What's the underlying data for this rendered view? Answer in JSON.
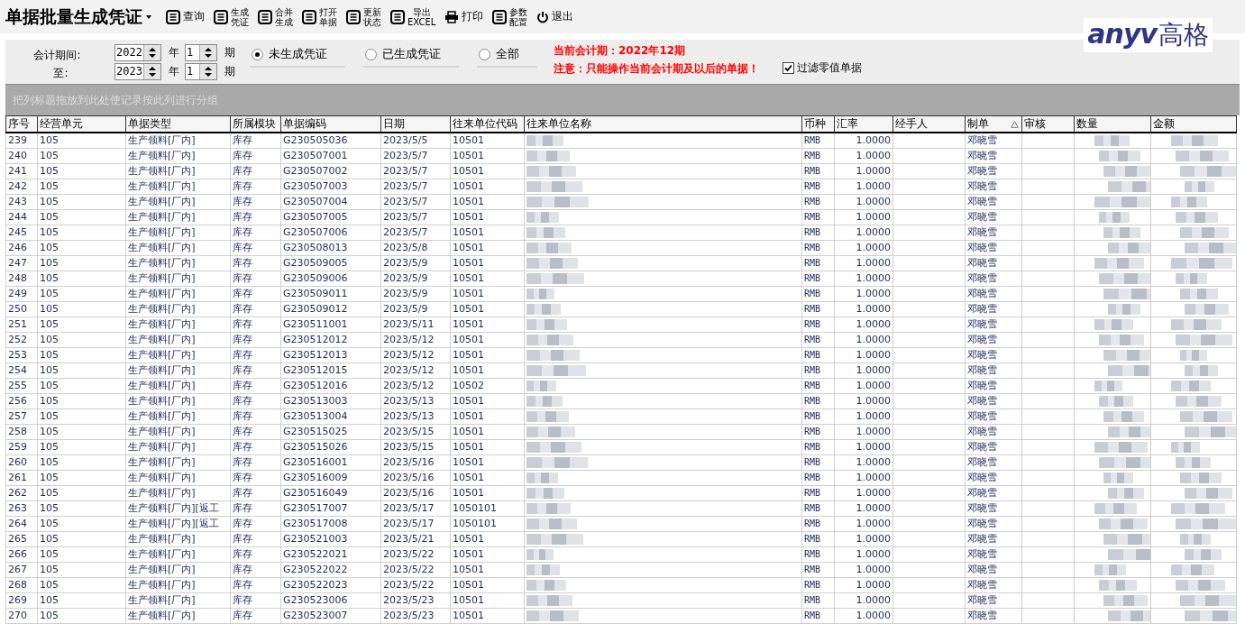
{
  "title": "单据批量生成凭证",
  "toolbar": [
    {
      "kind": "list",
      "lines": [
        "查询"
      ]
    },
    {
      "kind": "list",
      "lines": [
        "生成",
        "凭证"
      ]
    },
    {
      "kind": "list",
      "lines": [
        "合并",
        "生成"
      ]
    },
    {
      "kind": "list",
      "lines": [
        "打开",
        "单据"
      ]
    },
    {
      "kind": "list",
      "lines": [
        "更新",
        "状态"
      ]
    },
    {
      "kind": "list",
      "lines": [
        "导出",
        "EXCEL"
      ]
    },
    {
      "kind": "print",
      "lines": [
        "打印"
      ]
    },
    {
      "kind": "list",
      "lines": [
        "参数",
        "配置"
      ]
    },
    {
      "kind": "power",
      "lines": [
        "退出"
      ]
    }
  ],
  "logo": {
    "latin": "anyv",
    "cjk": "高格"
  },
  "filter": {
    "period_label": "会计期间:",
    "to_label": "至:",
    "from": {
      "year": "2022",
      "year_unit": "年",
      "month": "1",
      "month_unit": "期"
    },
    "to": {
      "year": "2023",
      "year_unit": "年",
      "month": "1",
      "month_unit": "期"
    },
    "radios": [
      {
        "label": "未生成凭证",
        "selected": true
      },
      {
        "label": "已生成凭证",
        "selected": false
      },
      {
        "label": "全部",
        "selected": false
      }
    ],
    "current_period": "当前会计期：2022年12期",
    "notice": "注意：只能操作当前会计期及以后的单据！",
    "filter_zero": {
      "label": "过滤零值单据",
      "checked": true
    }
  },
  "group_hint": "把列标题拖放到此处使记录按此列进行分组",
  "table": {
    "columns": [
      {
        "label": "序号",
        "sorted": false
      },
      {
        "label": "经营单元",
        "sorted": false
      },
      {
        "label": "单据类型",
        "sorted": false
      },
      {
        "label": "所属模块",
        "sorted": false
      },
      {
        "label": "单据编码",
        "sorted": false
      },
      {
        "label": "日期",
        "sorted": false
      },
      {
        "label": "往来单位代码",
        "sorted": false
      },
      {
        "label": "往来单位名称",
        "sorted": false
      },
      {
        "label": "币种",
        "sorted": false
      },
      {
        "label": "汇率",
        "sorted": false
      },
      {
        "label": "经手人",
        "sorted": false
      },
      {
        "label": "制单",
        "sorted": true
      },
      {
        "label": "审核",
        "sorted": false
      },
      {
        "label": "数量",
        "sorted": false
      },
      {
        "label": "金额",
        "sorted": false
      }
    ],
    "rows": [
      [
        "239",
        "105",
        "生产领料[厂内]",
        "库存",
        "G230505036",
        "2023/5/5",
        "10501",
        "",
        "RMB",
        "1.0000",
        "",
        "邓晓雪",
        "",
        "",
        ""
      ],
      [
        "240",
        "105",
        "生产领料[厂内]",
        "库存",
        "G230507001",
        "2023/5/7",
        "10501",
        "",
        "RMB",
        "1.0000",
        "",
        "邓晓雪",
        "",
        "",
        ""
      ],
      [
        "241",
        "105",
        "生产领料[厂内]",
        "库存",
        "G230507002",
        "2023/5/7",
        "10501",
        "",
        "RMB",
        "1.0000",
        "",
        "邓晓雪",
        "",
        "",
        ""
      ],
      [
        "242",
        "105",
        "生产领料[厂内]",
        "库存",
        "G230507003",
        "2023/5/7",
        "10501",
        "",
        "RMB",
        "1.0000",
        "",
        "邓晓雪",
        "",
        "",
        ""
      ],
      [
        "243",
        "105",
        "生产领料[厂内]",
        "库存",
        "G230507004",
        "2023/5/7",
        "10501",
        "",
        "RMB",
        "1.0000",
        "",
        "邓晓雪",
        "",
        "",
        ""
      ],
      [
        "244",
        "105",
        "生产领料[厂内]",
        "库存",
        "G230507005",
        "2023/5/7",
        "10501",
        "",
        "RMB",
        "1.0000",
        "",
        "邓晓雪",
        "",
        "",
        ""
      ],
      [
        "245",
        "105",
        "生产领料[厂内]",
        "库存",
        "G230507006",
        "2023/5/7",
        "10501",
        "",
        "RMB",
        "1.0000",
        "",
        "邓晓雪",
        "",
        "",
        ""
      ],
      [
        "246",
        "105",
        "生产领料[厂内]",
        "库存",
        "G230508013",
        "2023/5/8",
        "10501",
        "",
        "RMB",
        "1.0000",
        "",
        "邓晓雪",
        "",
        "",
        ""
      ],
      [
        "247",
        "105",
        "生产领料[厂内]",
        "库存",
        "G230509005",
        "2023/5/9",
        "10501",
        "",
        "RMB",
        "1.0000",
        "",
        "邓晓雪",
        "",
        "",
        ""
      ],
      [
        "248",
        "105",
        "生产领料[厂内]",
        "库存",
        "G230509006",
        "2023/5/9",
        "10501",
        "",
        "RMB",
        "1.0000",
        "",
        "邓晓雪",
        "",
        "",
        ""
      ],
      [
        "249",
        "105",
        "生产领料[厂内]",
        "库存",
        "G230509011",
        "2023/5/9",
        "10501",
        "",
        "RMB",
        "1.0000",
        "",
        "邓晓雪",
        "",
        "",
        ""
      ],
      [
        "250",
        "105",
        "生产领料[厂内]",
        "库存",
        "G230509012",
        "2023/5/9",
        "10501",
        "",
        "RMB",
        "1.0000",
        "",
        "邓晓雪",
        "",
        "",
        ""
      ],
      [
        "251",
        "105",
        "生产领料[厂内]",
        "库存",
        "G230511001",
        "2023/5/11",
        "10501",
        "",
        "RMB",
        "1.0000",
        "",
        "邓晓雪",
        "",
        "",
        ""
      ],
      [
        "252",
        "105",
        "生产领料[厂内]",
        "库存",
        "G230512012",
        "2023/5/12",
        "10501",
        "",
        "RMB",
        "1.0000",
        "",
        "邓晓雪",
        "",
        "",
        ""
      ],
      [
        "253",
        "105",
        "生产领料[厂内]",
        "库存",
        "G230512013",
        "2023/5/12",
        "10501",
        "",
        "RMB",
        "1.0000",
        "",
        "邓晓雪",
        "",
        "",
        ""
      ],
      [
        "254",
        "105",
        "生产领料[厂内]",
        "库存",
        "G230512015",
        "2023/5/12",
        "10501",
        "",
        "RMB",
        "1.0000",
        "",
        "邓晓雪",
        "",
        "",
        ""
      ],
      [
        "255",
        "105",
        "生产领料[厂内]",
        "库存",
        "G230512016",
        "2023/5/12",
        "10502",
        "",
        "RMB",
        "1.0000",
        "",
        "邓晓雪",
        "",
        "",
        ""
      ],
      [
        "256",
        "105",
        "生产领料[厂内]",
        "库存",
        "G230513003",
        "2023/5/13",
        "10501",
        "",
        "RMB",
        "1.0000",
        "",
        "邓晓雪",
        "",
        "",
        ""
      ],
      [
        "257",
        "105",
        "生产领料[厂内]",
        "库存",
        "G230513004",
        "2023/5/13",
        "10501",
        "",
        "RMB",
        "1.0000",
        "",
        "邓晓雪",
        "",
        "",
        ""
      ],
      [
        "258",
        "105",
        "生产领料[厂内]",
        "库存",
        "G230515025",
        "2023/5/15",
        "10501",
        "",
        "RMB",
        "1.0000",
        "",
        "邓晓雪",
        "",
        "",
        ""
      ],
      [
        "259",
        "105",
        "生产领料[厂内]",
        "库存",
        "G230515026",
        "2023/5/15",
        "10501",
        "",
        "RMB",
        "1.0000",
        "",
        "邓晓雪",
        "",
        "",
        ""
      ],
      [
        "260",
        "105",
        "生产领料[厂内]",
        "库存",
        "G230516001",
        "2023/5/16",
        "10501",
        "",
        "RMB",
        "1.0000",
        "",
        "邓晓雪",
        "",
        "",
        ""
      ],
      [
        "261",
        "105",
        "生产领料[厂内]",
        "库存",
        "G230516009",
        "2023/5/16",
        "10501",
        "",
        "RMB",
        "1.0000",
        "",
        "邓晓雪",
        "",
        "",
        ""
      ],
      [
        "262",
        "105",
        "生产领料[厂内]",
        "库存",
        "G230516049",
        "2023/5/16",
        "10501",
        "",
        "RMB",
        "1.0000",
        "",
        "邓晓雪",
        "",
        "",
        ""
      ],
      [
        "263",
        "105",
        "生产领料[厂内][返工",
        "库存",
        "G230517007",
        "2023/5/17",
        "1050101",
        "",
        "RMB",
        "1.0000",
        "",
        "邓晓雪",
        "",
        "",
        ""
      ],
      [
        "264",
        "105",
        "生产领料[厂内][返工",
        "库存",
        "G230517008",
        "2023/5/17",
        "1050101",
        "",
        "RMB",
        "1.0000",
        "",
        "邓晓雪",
        "",
        "",
        ""
      ],
      [
        "265",
        "105",
        "生产领料[厂内]",
        "库存",
        "G230521003",
        "2023/5/21",
        "10501",
        "",
        "RMB",
        "1.0000",
        "",
        "邓晓雪",
        "",
        "",
        ""
      ],
      [
        "266",
        "105",
        "生产领料[厂内]",
        "库存",
        "G230522021",
        "2023/5/22",
        "10501",
        "",
        "RMB",
        "1.0000",
        "",
        "邓晓雪",
        "",
        "",
        ""
      ],
      [
        "267",
        "105",
        "生产领料[厂内]",
        "库存",
        "G230522022",
        "2023/5/22",
        "10501",
        "",
        "RMB",
        "1.0000",
        "",
        "邓晓雪",
        "",
        "",
        ""
      ],
      [
        "268",
        "105",
        "生产领料[厂内]",
        "库存",
        "G230522023",
        "2023/5/22",
        "10501",
        "",
        "RMB",
        "1.0000",
        "",
        "邓晓雪",
        "",
        "",
        ""
      ],
      [
        "269",
        "105",
        "生产领料[厂内]",
        "库存",
        "G230523006",
        "2023/5/23",
        "10501",
        "",
        "RMB",
        "1.0000",
        "",
        "邓晓雪",
        "",
        "",
        ""
      ],
      [
        "270",
        "105",
        "生产领料[厂内]",
        "库存",
        "G230523007",
        "2023/5/23",
        "10501",
        "",
        "RMB",
        "1.0000",
        "",
        "邓晓雪",
        "",
        "",
        ""
      ]
    ]
  }
}
